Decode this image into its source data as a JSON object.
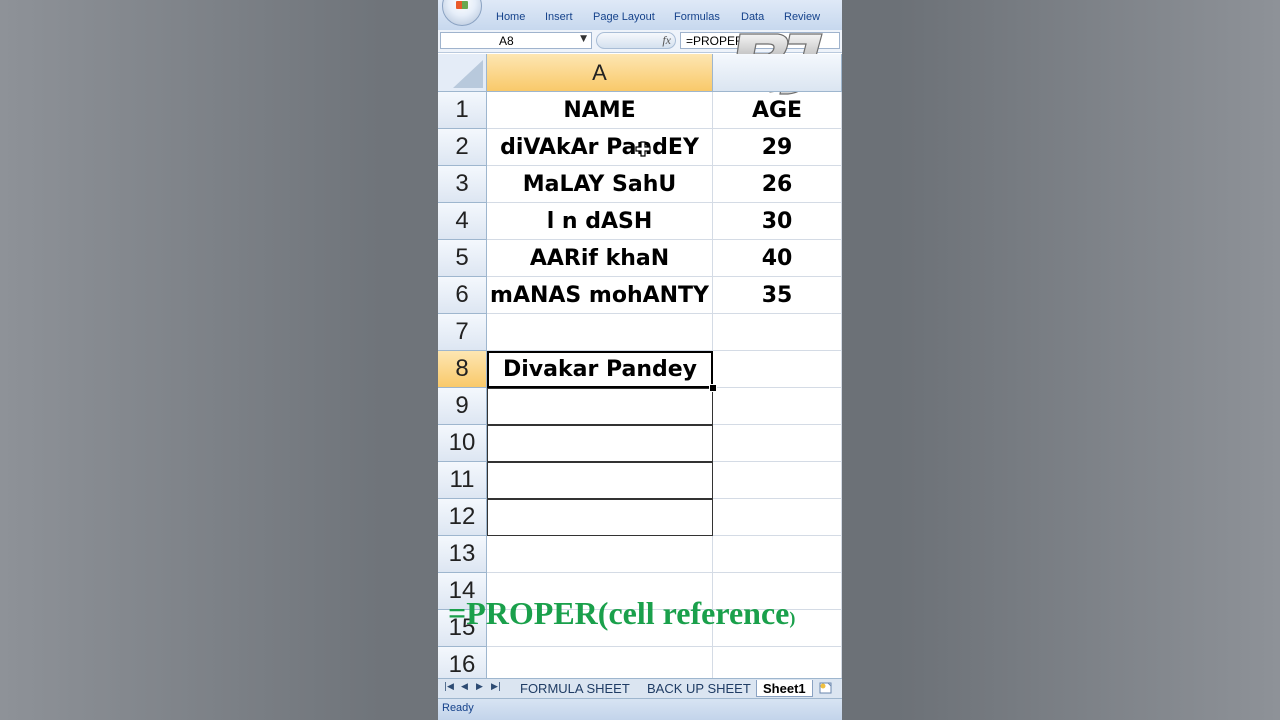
{
  "ribbon": {
    "tabs": [
      "Home",
      "Insert",
      "Page Layout",
      "Formulas",
      "Data",
      "Review"
    ]
  },
  "formula_bar": {
    "name_box": "A8",
    "fx_label": "fx",
    "formula": "=PROPER"
  },
  "grid": {
    "columns": [
      "A",
      ""
    ],
    "rows": [
      "1",
      "2",
      "3",
      "4",
      "5",
      "6",
      "7",
      "8",
      "9",
      "10",
      "11",
      "12",
      "13",
      "14",
      "15",
      "16"
    ],
    "cells": [
      [
        "NAME",
        "AGE"
      ],
      [
        "diVAkAr PandEY",
        "29"
      ],
      [
        "MaLAY SahU",
        "26"
      ],
      [
        "l n dASH",
        "30"
      ],
      [
        "AARif khaN",
        "40"
      ],
      [
        "mANAS mohANTY",
        "35"
      ],
      [
        "",
        ""
      ],
      [
        "Divakar Pandey",
        ""
      ],
      [
        "",
        ""
      ],
      [
        "",
        ""
      ],
      [
        "",
        ""
      ],
      [
        "",
        ""
      ],
      [
        "",
        ""
      ],
      [
        "",
        ""
      ],
      [
        "",
        ""
      ],
      [
        "",
        ""
      ]
    ],
    "active_cell": "A8"
  },
  "overlay": {
    "caption_main": "=PROPER(cell reference",
    "caption_close": ")",
    "color": "#1aa04b"
  },
  "sheet_tabs": [
    "FORMULA SHEET",
    "BACK UP SHEET",
    "Sheet1"
  ],
  "active_sheet": "Sheet1",
  "status": "Ready",
  "colors": {
    "selected_header": "#f9c96a",
    "ribbon_text": "#15428b",
    "grid_line": "#d4dbe5"
  }
}
